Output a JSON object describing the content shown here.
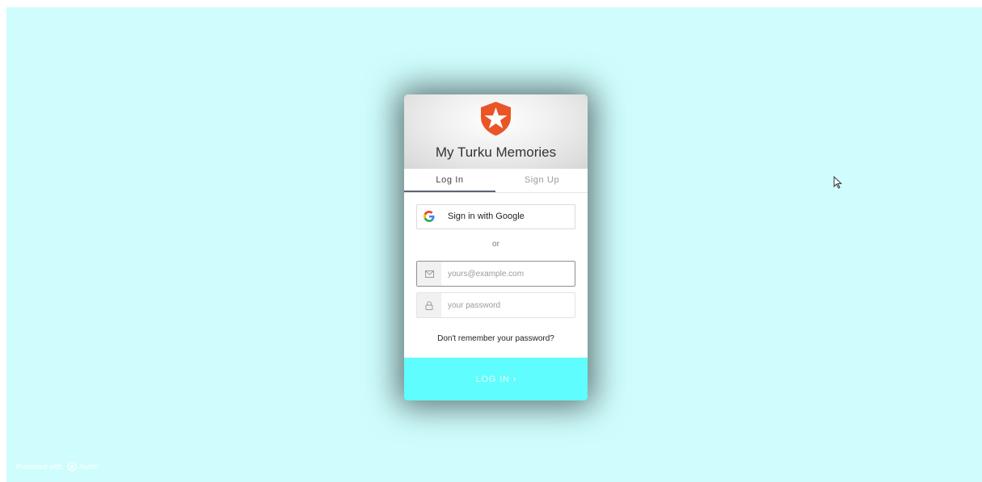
{
  "colors": {
    "background": "#cffdfd",
    "primary_button": "#5ffdfd",
    "logo": "#eb5424"
  },
  "header": {
    "logo_icon": "auth0-star-shield-icon",
    "title": "My Turku Memories"
  },
  "tabs": [
    {
      "label": "Log In",
      "active": true
    },
    {
      "label": "Sign Up",
      "active": false
    }
  ],
  "social": {
    "google_icon": "google-g-icon",
    "google_label": "Sign in with Google"
  },
  "separator": "or",
  "email": {
    "icon": "envelope-icon",
    "placeholder": "yours@example.com",
    "value": ""
  },
  "password": {
    "icon": "lock-icon",
    "placeholder": "your password",
    "value": ""
  },
  "forgot_link": "Don't remember your password?",
  "submit": {
    "label": "LOG IN",
    "icon": "chevron-right-icon",
    "chevron": "›"
  },
  "badge": {
    "prefix": "Protected with",
    "brand": "Auth0",
    "icon": "auth0-badge-icon"
  }
}
